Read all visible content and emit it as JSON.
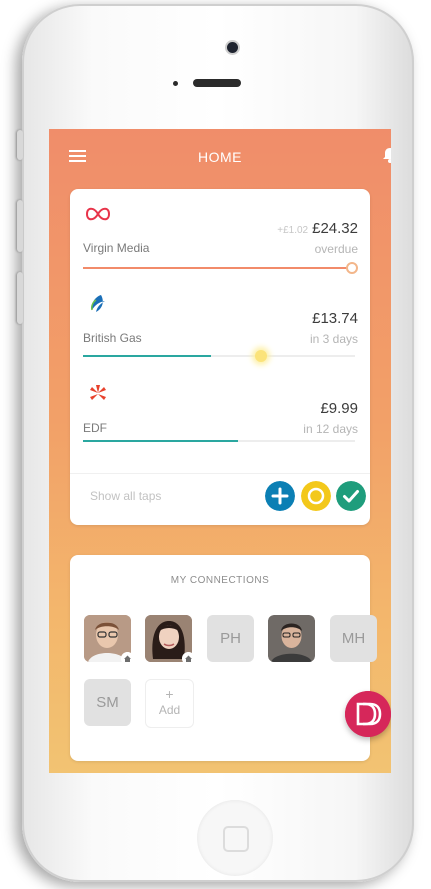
{
  "header": {
    "title": "HOME"
  },
  "bills": [
    {
      "name": "Virgin Media",
      "previous": "+£1.02",
      "amount": "£24.32",
      "due": "overdue",
      "progress": 0.99,
      "bar_color": "#f28b6a",
      "logo": "virgin-media-logo"
    },
    {
      "name": "British Gas",
      "previous": "",
      "amount": "£13.74",
      "due": "in 3 days",
      "progress": 0.47,
      "bar_color": "#2aa7a0",
      "logo": "british-gas-logo"
    },
    {
      "name": "EDF",
      "previous": "",
      "amount": "£9.99",
      "due": "in 12 days",
      "progress": 0.57,
      "bar_color": "#2aa7a0",
      "logo": "edf-logo"
    }
  ],
  "show_all": "Show all taps",
  "actions": {
    "add": {
      "color": "#0b7fb4"
    },
    "pending": {
      "color": "#f3c81b"
    },
    "paid": {
      "color": "#1f9d7c"
    }
  },
  "connections": {
    "title": "MY CONNECTIONS",
    "people": [
      {
        "type": "photo",
        "home": true
      },
      {
        "type": "photo",
        "home": true
      },
      {
        "type": "initials",
        "initials": "PH"
      },
      {
        "type": "photo",
        "home": false
      },
      {
        "type": "initials",
        "initials": "MH"
      },
      {
        "type": "initials",
        "initials": "SM"
      }
    ],
    "add_label": "Add",
    "add_symbol": "+"
  },
  "colors": {
    "accent": "#f08d6a",
    "fab": "#d6275a"
  }
}
